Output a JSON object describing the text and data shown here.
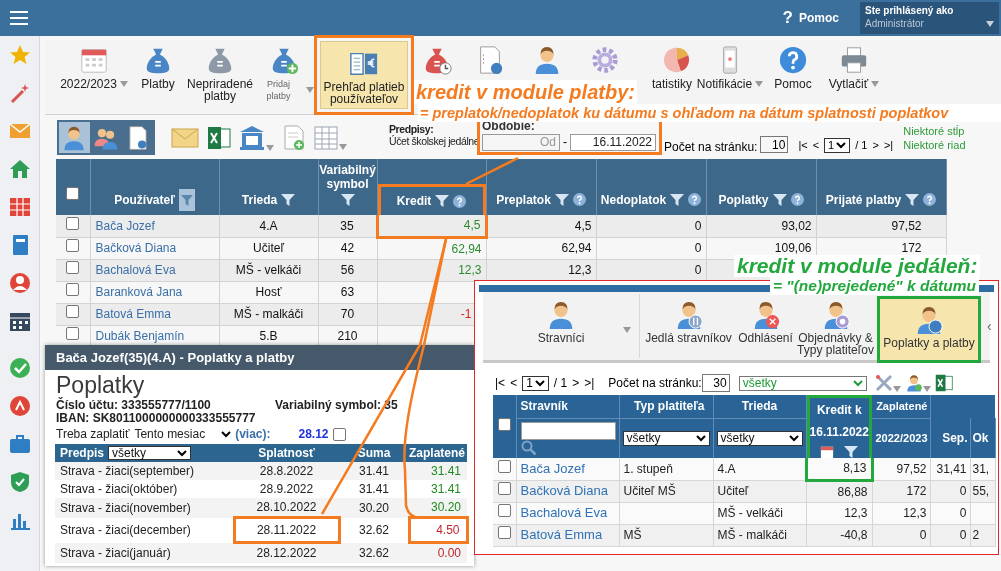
{
  "top_bar": {
    "help_icon": "?",
    "help": "Pomoc",
    "login_label": "Ste prihlásený ako",
    "login_value": "Administrátor"
  },
  "toolbar": {
    "items": [
      {
        "label": "2022/2023",
        "dropdown": true,
        "small": false,
        "selected": false,
        "highlighted": false
      },
      {
        "label": "Platby",
        "dropdown": false,
        "small": false,
        "selected": false,
        "highlighted": false
      },
      {
        "label": "Nepriradené platby",
        "dropdown": false,
        "small": false,
        "selected": false,
        "highlighted": false
      },
      {
        "label": "Pridaj platby",
        "dropdown": true,
        "small": true,
        "selected": false,
        "highlighted": false
      },
      {
        "label": "Prehľad platieb používateľov",
        "dropdown": false,
        "small": false,
        "selected": true,
        "highlighted": true
      },
      {
        "dropdown": false,
        "selected": false,
        "highlighted": false
      },
      {
        "dropdown": false,
        "selected": false,
        "highlighted": false
      },
      {
        "dropdown": false,
        "selected": false,
        "highlighted": false
      },
      {
        "dropdown": false,
        "selected": false,
        "highlighted": false
      },
      {
        "label": "tatistiky",
        "dropdown": false,
        "small": false,
        "selected": false,
        "highlighted": false
      },
      {
        "label": "Notifikácie",
        "dropdown": true,
        "small": false,
        "selected": false,
        "highlighted": false
      },
      {
        "label": "Pomoc",
        "dropdown": false,
        "small": false,
        "selected": false,
        "highlighted": false
      },
      {
        "label": "Vytlačiť",
        "dropdown": true,
        "small": false,
        "selected": false,
        "highlighted": false
      }
    ]
  },
  "view_buttons": [
    {
      "selected": true
    },
    {
      "selected": false
    },
    {
      "selected": false
    }
  ],
  "filter_bar": {
    "predpisy_label": "Predpisy:",
    "predpisy_value": "Účet školskej jedálne",
    "period_highlighted": true,
    "period_label": "Obdobie:",
    "from_placeholder": "Od",
    "separator": "-",
    "to_value": "16.11.2022",
    "per_page_label": "Počet na stránku:",
    "per_page": "10",
    "pager": {
      "first": "|<",
      "prev": "<",
      "page": "1",
      "total": "/ 1",
      "next": ">",
      "last": ">|"
    },
    "notices": [
      "Niektoré stĺp",
      "Niektoré riad"
    ]
  },
  "users_table": {
    "select_all_checked": false,
    "columns": [
      {
        "label": "Používateľ",
        "filter": true,
        "filter_active": true,
        "help": false,
        "highlighted": false
      },
      {
        "label": "Trieda",
        "filter": true,
        "filter_active": false,
        "help": false,
        "highlighted": false
      },
      {
        "label": "Variabilný symbol",
        "filter": true,
        "filter_active": false,
        "help": false,
        "highlighted": false
      },
      {
        "label": "Kredit",
        "filter": true,
        "filter_active": false,
        "help": true,
        "highlighted": true
      },
      {
        "label": "Preplatok",
        "filter": true,
        "filter_active": false,
        "help": true,
        "highlighted": false
      },
      {
        "label": "Nedoplatok",
        "filter": true,
        "filter_active": false,
        "help": true,
        "highlighted": false
      },
      {
        "label": "Poplatky",
        "filter": true,
        "filter_active": false,
        "help": true,
        "highlighted": false
      },
      {
        "label": "Prijaté platby",
        "filter": true,
        "filter_active": false,
        "help": true,
        "highlighted": false
      }
    ],
    "rows": [
      {
        "checked": false,
        "name": "Bača Jozef",
        "trieda": "4.A",
        "vs": "35",
        "kredit": "4,5",
        "kredit_negative": false,
        "kredit_highlighted": true,
        "preplatok": "4,5",
        "nedoplatok": "0",
        "poplatky": "93,02",
        "prijate": "97,52"
      },
      {
        "checked": false,
        "name": "Bačková Diana",
        "trieda": "Učiteľ",
        "vs": "42",
        "kredit": "62,94",
        "kredit_negative": false,
        "kredit_highlighted": false,
        "preplatok": "62,94",
        "nedoplatok": "0",
        "poplatky": "109,06",
        "prijate": "172"
      },
      {
        "checked": false,
        "name": "Bachalová Eva",
        "trieda": "MŠ - velkáči",
        "vs": "56",
        "kredit": "12,3",
        "kredit_negative": false,
        "kredit_highlighted": false,
        "preplatok": "12,3",
        "nedoplatok": "0"
      },
      {
        "checked": false,
        "name": "Baranková Jana",
        "trieda": "Hosť",
        "vs": "63",
        "kredit_highlighted": false
      },
      {
        "checked": false,
        "name": "Batová Emma",
        "trieda": "MŠ - malkáči",
        "vs": "70",
        "kredit": "-1",
        "kredit_negative": true,
        "kredit_highlighted": false
      },
      {
        "checked": false,
        "name": "Dubák Benjamín",
        "trieda": "5.B",
        "vs": "210",
        "kredit_highlighted": false
      }
    ]
  },
  "fees_panel": {
    "title": "Bača Jozef(35)(4.A) - Poplatky a platby",
    "heading": "Poplatky",
    "account": "Číslo účtu: 333555777/1100",
    "vs": "Variabilný symbol: 35",
    "iban": "IBAN: SK8011000000000333555777",
    "due_label": "Treba zaplatiť",
    "due_period": "Tento mesiac",
    "more": "(viac):",
    "due_amount": "28.12",
    "due_checked": false,
    "columns": [
      "Predpis",
      "Splatnosť",
      "Suma",
      "Zaplatené"
    ],
    "predpis_filter": "všetky",
    "rows": [
      {
        "name": "Strava - žiaci(september)",
        "due": "28.8.2022",
        "sum": "31.41",
        "paid": "31.41",
        "settled": true,
        "highlighted": false
      },
      {
        "name": "Strava - žiaci(október)",
        "due": "28.9.2022",
        "sum": "31.41",
        "paid": "31.41",
        "settled": true,
        "highlighted": false
      },
      {
        "name": "Strava - žiaci(november)",
        "due": "28.10.2022",
        "sum": "30.20",
        "paid": "30.20",
        "settled": true,
        "highlighted": false
      },
      {
        "name": "Strava - žiaci(december)",
        "due": "28.11.2022",
        "sum": "32.62",
        "paid": "4.50",
        "settled": false,
        "highlighted": true
      },
      {
        "name": "Strava - žiaci(január)",
        "due": "28.12.2022",
        "sum": "32.62",
        "paid": "0.00",
        "settled": false,
        "highlighted": false
      }
    ]
  },
  "canteen_panel": {
    "toolbar": [
      {
        "label": "Stravníci",
        "dropdown": true,
        "selected": false,
        "highlighted": false
      },
      {
        "label": "Jedlá stravníkov",
        "dropdown": false,
        "selected": false,
        "highlighted": false
      },
      {
        "label": "Odhlásení",
        "dropdown": false,
        "selected": false,
        "highlighted": false
      },
      {
        "label": "Objednávky & Typy platiteľov",
        "dropdown": false,
        "selected": false,
        "highlighted": false
      },
      {
        "label": "Poplatky a platby",
        "dropdown": false,
        "selected": true,
        "highlighted": true
      }
    ],
    "scroll_arrow": "‹",
    "pager": {
      "first": "|<",
      "prev": "<",
      "page": "1",
      "total": "/ 1",
      "next": ">",
      "last": ">|"
    },
    "per_page_label": "Počet na stránku:",
    "per_page": "30",
    "filter": "všetky",
    "table": {
      "select_all_checked": false,
      "credit_highlighted": true,
      "headers": [
        "Stravník",
        "Typ platiteľa",
        "Trieda",
        "Kredit k",
        "Zaplatené"
      ],
      "type_filter": "všetky",
      "class_filter": "všetky",
      "credit_date": "16.11.2022",
      "subheaders": [
        "2022/2023",
        "Sep.",
        "Ok"
      ],
      "rows": [
        {
          "checked": false,
          "credit_highlighted": true,
          "name": "Bača Jozef",
          "type": "1. stupeň",
          "class": "4.A",
          "credit": "8,13",
          "paid": "97,52",
          "sep": "31,41",
          "oct": "31,"
        },
        {
          "checked": false,
          "credit_highlighted": false,
          "name": "Bačková Diana",
          "type": "Učiteľ MŠ",
          "class": "Učiteľ",
          "credit": "86,88",
          "paid": "172",
          "sep": "0",
          "oct": "55,"
        },
        {
          "checked": false,
          "credit_highlighted": false,
          "name": "Bachalová Eva",
          "class": "MŠ - velkáči",
          "credit": "12,3",
          "paid": "12,3",
          "sep": "0"
        },
        {
          "checked": false,
          "credit_highlighted": false,
          "name": "Batová Emma",
          "type": "MŠ",
          "class": "MŠ - malkáči",
          "credit": "-40,8",
          "paid": "0",
          "sep": "0",
          "oct": "2"
        }
      ]
    }
  },
  "payments_note": {
    "title": "kredit v module platby:",
    "subtitle": "= preplatok/nedoplatok ku dátumu s ohľadom na dátum splatnosti poplatkov"
  },
  "canteen_note": {
    "title": "kredit v module jedáleň:",
    "subtitle": "= \"(ne)prejedené\" k dátumu"
  }
}
